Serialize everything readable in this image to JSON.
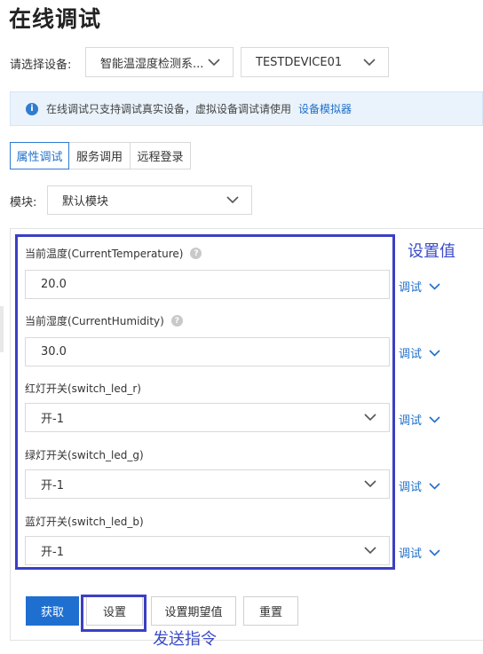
{
  "page": {
    "title": "在线调试"
  },
  "device_selector": {
    "label": "请选择设备:",
    "product": "智能温湿度检测系...",
    "device": "TESTDEVICE01"
  },
  "notice": {
    "text": "在线调试只支持调试真实设备，虚拟设备调试请使用",
    "link": "设备模拟器"
  },
  "tabs": [
    {
      "label": "属性调试",
      "active": true
    },
    {
      "label": "服务调用",
      "active": false
    },
    {
      "label": "远程登录",
      "active": false
    }
  ],
  "module": {
    "label": "模块:",
    "value": "默认模块"
  },
  "fields": [
    {
      "label": "当前温度(CurrentTemperature)",
      "value": "20.0",
      "kind": "input",
      "help": true
    },
    {
      "label": "当前湿度(CurrentHumidity)",
      "value": "30.0",
      "kind": "input",
      "help": true
    },
    {
      "label": "红灯开关(switch_led_r)",
      "value": "开-1",
      "kind": "select",
      "help": false
    },
    {
      "label": "绿灯开关(switch_led_g)",
      "value": "开-1",
      "kind": "select",
      "help": false
    },
    {
      "label": "蓝灯开关(switch_led_b)",
      "value": "开-1",
      "kind": "select",
      "help": false
    }
  ],
  "debug_label": "调试",
  "help_glyph": "?",
  "info_glyph": "i",
  "buttons": {
    "get": "获取",
    "set": "设置",
    "set_expected": "设置期望值",
    "reset": "重置"
  },
  "annotations": {
    "set_value": "设置值",
    "send_command": "发送指令"
  },
  "colors": {
    "accent": "#1f6fd0",
    "annotation": "#3b3fc4"
  }
}
